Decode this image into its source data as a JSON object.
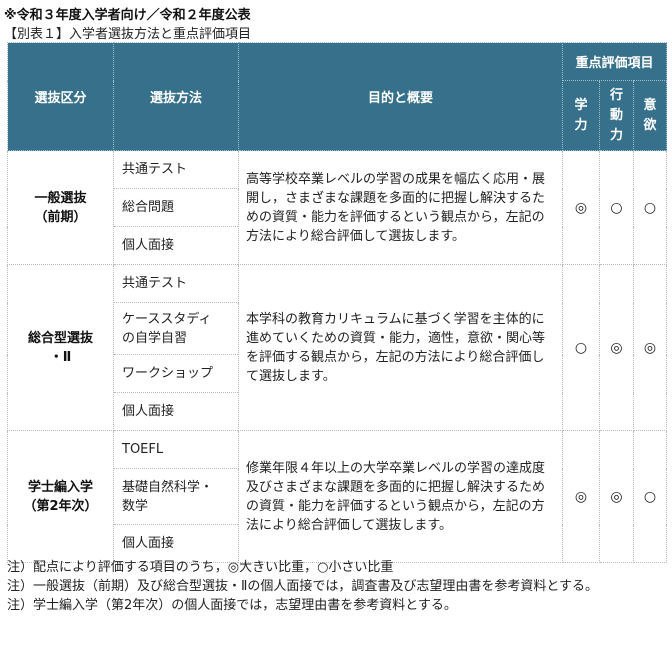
{
  "notice": "※令和３年度入学者向け／令和２年度公表",
  "caption": "【別表１】入学者選抜方法と重点評価項目",
  "header": {
    "category": "選抜区分",
    "method": "選抜方法",
    "purpose": "目的と概要",
    "focus": "重点評価項目",
    "criteria": [
      {
        "chars": [
          "学",
          "力"
        ]
      },
      {
        "chars": [
          "行",
          "動",
          "力"
        ]
      },
      {
        "chars": [
          "意",
          "欲"
        ]
      }
    ]
  },
  "sections": [
    {
      "category_lines": [
        "一般選抜",
        "（前期）"
      ],
      "methods": [
        {
          "lines": [
            "共通テスト"
          ]
        },
        {
          "lines": [
            "総合問題"
          ]
        },
        {
          "lines": [
            "個人面接"
          ]
        }
      ],
      "description": "高等学校卒業レベルの学習の成果を幅広く応用・展開し，さまざまな課題を多面的に把握し解決するための資質・能力を評価するという観点から，左記の方法により総合評価して選抜します。",
      "marks": [
        "◎",
        "○",
        "○"
      ]
    },
    {
      "category_lines": [
        "総合型選抜",
        "・Ⅱ"
      ],
      "methods": [
        {
          "lines": [
            "共通テスト"
          ]
        },
        {
          "lines": [
            "ケーススタディ",
            "の自学自習"
          ]
        },
        {
          "lines": [
            "ワークショップ"
          ]
        },
        {
          "lines": [
            "個人面接"
          ]
        }
      ],
      "description": "本学科の教育カリキュラムに基づく学習を主体的に進めていくための資質・能力，適性，意欲・関心等を評価する観点から，左記の方法により総合評価して選抜します。",
      "marks": [
        "○",
        "◎",
        "◎"
      ]
    },
    {
      "category_lines": [
        "学士編入学",
        "（第2年次）"
      ],
      "methods": [
        {
          "lines": [
            "TOEFL"
          ]
        },
        {
          "lines": [
            "基礎自然科学・",
            "数学"
          ]
        },
        {
          "lines": [
            "個人面接"
          ]
        }
      ],
      "description": "修業年限４年以上の大学卒業レベルの学習の達成度及びさまざまな課題を多面的に把握し解決するための資質・能力を評価するという観点から，左記の方法により総合評価して選抜します。",
      "marks": [
        "◎",
        "◎",
        "○"
      ]
    }
  ],
  "notes": [
    "注）配点により評価する項目のうち，◎大きい比重，○小さい比重",
    "注）一般選抜（前期）及び総合型選抜・Ⅱの個人面接では，調査書及び志望理由書を参考資料とする。",
    "注）学士編入学（第2年次）の個人面接では，志望理由書を参考資料とする。"
  ]
}
